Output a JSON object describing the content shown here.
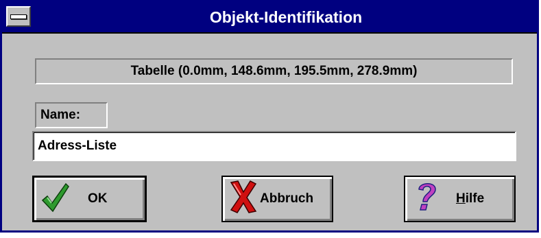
{
  "window": {
    "title": "Objekt-Identifikation"
  },
  "object_info": {
    "text": "Tabelle (0.0mm, 148.6mm, 195.5mm, 278.9mm)"
  },
  "name_field": {
    "label": "Name:",
    "value": "Adress-Liste"
  },
  "buttons": {
    "ok": {
      "label": "OK",
      "icon": "checkmark-icon"
    },
    "cancel": {
      "label": "Abbruch",
      "icon": "red-x-icon"
    },
    "help": {
      "label": "Hilfe",
      "icon": "question-mark-icon"
    }
  },
  "colors": {
    "titlebar": "#000080",
    "dialog_bg": "#c0c0c0",
    "check": "#2e9a2e",
    "cross": "#d01010",
    "question": "#c040c0"
  }
}
